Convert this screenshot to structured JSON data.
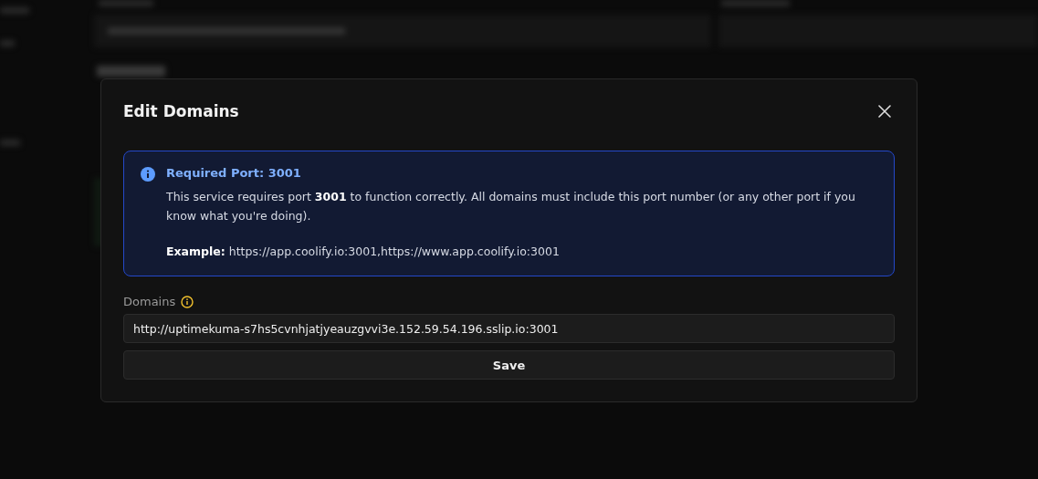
{
  "dialog": {
    "title": "Edit Domains",
    "notice": {
      "title": "Required Port: 3001",
      "body": "This service requires port **3001** to function correctly. All domains must include this port number (or any other port if you know what you're doing).",
      "example": "**Example:** https://app.coolify.io:3001,https://www.app.coolify.io:3001"
    },
    "domains": {
      "label": "Domains",
      "value": "http://uptimekuma-s7hs5cvnhjatjyeauzgvvi3e.152.59.54.196.sslip.io:3001"
    },
    "buttons": [
      "Save"
    ]
  }
}
